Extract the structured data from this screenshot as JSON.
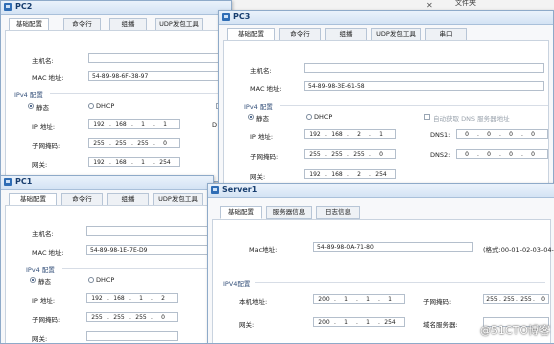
{
  "tabs": {
    "basic": "基础配置",
    "cmd": "命令行",
    "multicast": "组播",
    "udp": "UDP发包工具",
    "serial": "串口",
    "server_info": "服务器信息",
    "log_info": "日志信息"
  },
  "labels": {
    "hostname": "主机名:",
    "mac": "MAC 地址:",
    "ipv4": "IPv4 配置",
    "static": "静态",
    "dhcp": "DHCP",
    "ip": "IP 地址:",
    "mask": "子网掩码:",
    "gateway": "网关:",
    "dns1": "DNS1:",
    "dns2": "DNS2:",
    "auto_dns": "自动获取 DNS 服务器地址",
    "server_mac": "Mac地址:",
    "server_ipv4": "IPV4配置",
    "server_ip": "本机地址:",
    "server_mask": "子网掩码:",
    "server_gateway": "网关:",
    "server_dns": "域名服务器:",
    "mac_format": "(格式:00-01-02-03-04-0"
  },
  "top_right_text": "文件夹",
  "watermark": "@51CTO博客",
  "pc2": {
    "title": "PC2",
    "mac": "54-89-98-6F-38-97",
    "ip": [
      "192",
      "168",
      "1",
      "1"
    ],
    "mask": [
      "255",
      "255",
      "255",
      "0"
    ],
    "gateway": [
      "192",
      "168",
      "1",
      "254"
    ],
    "dns_partial": "D"
  },
  "pc3": {
    "title": "PC3",
    "mac": "54-89-98-3E-61-58",
    "ip": [
      "192",
      "168",
      "2",
      "1"
    ],
    "mask": [
      "255",
      "255",
      "255",
      "0"
    ],
    "gateway": [
      "192",
      "168",
      "2",
      "254"
    ],
    "dns1": [
      "0",
      "0",
      "0",
      "0"
    ],
    "dns2": [
      "0",
      "0",
      "0",
      "0"
    ]
  },
  "pc1": {
    "title": "PC1",
    "mac": "54-89-98-1E-7E-D9",
    "ip": [
      "192",
      "168",
      "1",
      "2"
    ],
    "mask": [
      "255",
      "255",
      "255",
      "0"
    ]
  },
  "server1": {
    "title": "Server1",
    "mac": "54-89-98-0A-71-80",
    "ip": [
      "200",
      "1",
      "1",
      "1"
    ],
    "mask": [
      "255",
      "255",
      "255",
      "0"
    ],
    "gateway": [
      "200",
      "1",
      "1",
      "254"
    ]
  }
}
